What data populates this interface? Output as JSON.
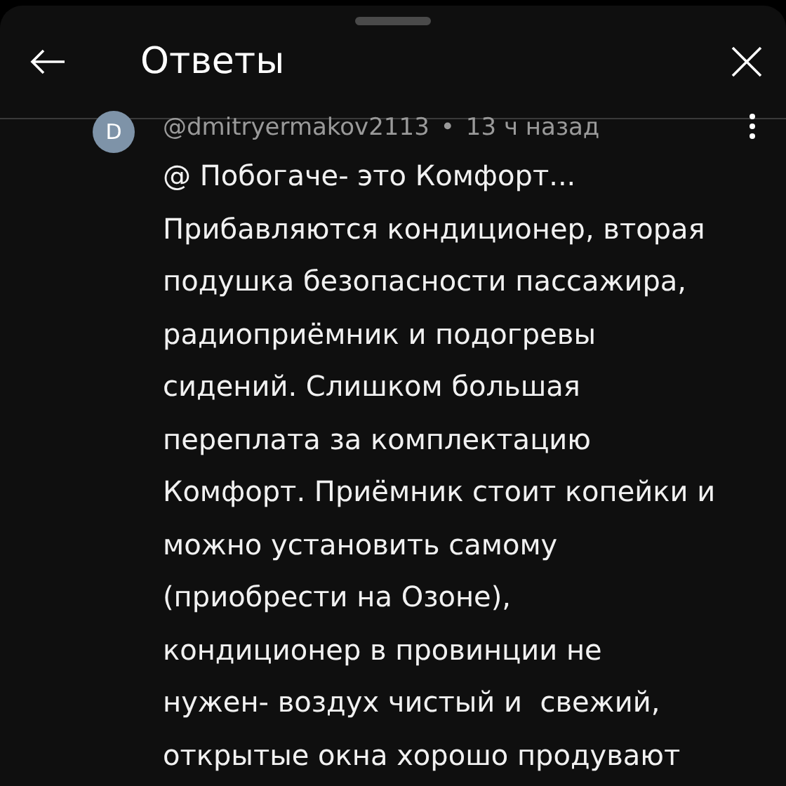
{
  "header": {
    "title": "Ответы"
  },
  "comment": {
    "avatar_letter": "D",
    "author": "@dmitryermakov2113",
    "separator": "•",
    "time": "13 ч назад",
    "body_lines": [
      "@ Побогаче- это Комфорт...",
      "Прибавляются кондиционер, вторая",
      "подушка безопасности пассажира,",
      "радиоприёмник и подогревы",
      "сидений. Слишком большая",
      "переплата за комплектацию",
      "Комфорт. Приёмник стоит копейки и",
      "можно установить самому",
      "(приобрести на Озоне),",
      "кондиционер в провинции не",
      "нужен- воздух чистый и  свежий,",
      "открытые окна хорошо продувают"
    ]
  }
}
